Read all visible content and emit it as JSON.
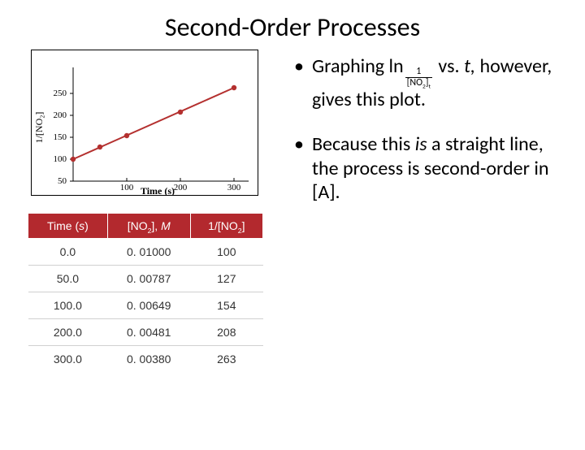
{
  "title": "Second-Order Processes",
  "bullets": {
    "b1_pre": "Graphing ln",
    "b1_num": "1",
    "b1_den_a": "[NO",
    "b1_den_sub": "2",
    "b1_den_c": "]",
    "b1_den_t": "t",
    "b1_post1": " vs. ",
    "b1_post_i": "t,",
    "b1_post2": " however, gives this plot.",
    "b2a": "Because this ",
    "b2b": "is",
    "b2c": " a straight line, the process is second-order in [A]."
  },
  "table": {
    "h1a": "Time (",
    "h1b": "s",
    "h1c": ")",
    "h2a": "[NO",
    "h2sub": "2",
    "h2b": "], ",
    "h2c": "M",
    "h3a": "1/[NO",
    "h3sub": "2",
    "h3b": "]",
    "rows": [
      {
        "t": "0.0",
        "c": "0. 01000",
        "r": "100"
      },
      {
        "t": "50.0",
        "c": "0. 00787",
        "r": "127"
      },
      {
        "t": "100.0",
        "c": "0. 00649",
        "r": "154"
      },
      {
        "t": "200.0",
        "c": "0. 00481",
        "r": "208"
      },
      {
        "t": "300.0",
        "c": "0. 00380",
        "r": "263"
      }
    ]
  },
  "chart_data": {
    "type": "scatter",
    "title": "",
    "xlabel": "Time (s)",
    "ylabel": "1/[NO₂]",
    "xlim": [
      0,
      320
    ],
    "ylim": [
      40,
      280
    ],
    "x_ticks": [
      100,
      200,
      300
    ],
    "y_ticks": [
      50,
      100,
      150,
      200,
      250
    ],
    "x": [
      0,
      50,
      100,
      200,
      300
    ],
    "y": [
      100,
      127,
      154,
      208,
      263
    ],
    "fit_line": {
      "x": [
        0,
        300
      ],
      "y": [
        100,
        263
      ]
    }
  }
}
